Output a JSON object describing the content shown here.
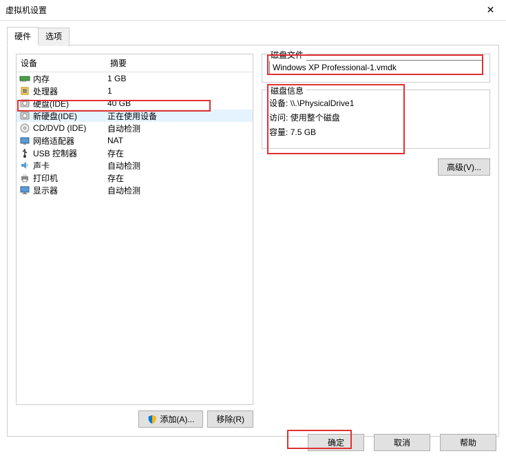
{
  "window": {
    "title": "虚拟机设置"
  },
  "tabs": {
    "hardware": "硬件",
    "options": "选项"
  },
  "headers": {
    "device": "设备",
    "summary": "摘要"
  },
  "devices": [
    {
      "icon": "memory",
      "name": "内存",
      "summary": "1 GB"
    },
    {
      "icon": "cpu",
      "name": "处理器",
      "summary": "1"
    },
    {
      "icon": "disk",
      "name": "硬盘(IDE)",
      "summary": "40 GB"
    },
    {
      "icon": "disk",
      "name": "新硬盘(IDE)",
      "summary": "正在使用设备",
      "selected": true
    },
    {
      "icon": "cd",
      "name": "CD/DVD (IDE)",
      "summary": "自动检测"
    },
    {
      "icon": "net",
      "name": "网络适配器",
      "summary": "NAT"
    },
    {
      "icon": "usb",
      "name": "USB 控制器",
      "summary": "存在"
    },
    {
      "icon": "sound",
      "name": "声卡",
      "summary": "自动检测"
    },
    {
      "icon": "printer",
      "name": "打印机",
      "summary": "存在"
    },
    {
      "icon": "display",
      "name": "显示器",
      "summary": "自动检测"
    }
  ],
  "buttons": {
    "add": "添加(A)...",
    "remove": "移除(R)",
    "advanced": "高级(V)...",
    "ok": "确定",
    "cancel": "取消",
    "help": "帮助"
  },
  "group": {
    "disk_file": "磁盘文件",
    "disk_info": "磁盘信息"
  },
  "disk_file_value": "Windows XP Professional-1.vmdk",
  "info": {
    "device_label": "设备:",
    "device_value": "\\\\.\\PhysicalDrive1",
    "access_label": "访问:",
    "access_value": "使用整个磁盘",
    "capacity_label": "容量:",
    "capacity_value": "7.5 GB"
  }
}
